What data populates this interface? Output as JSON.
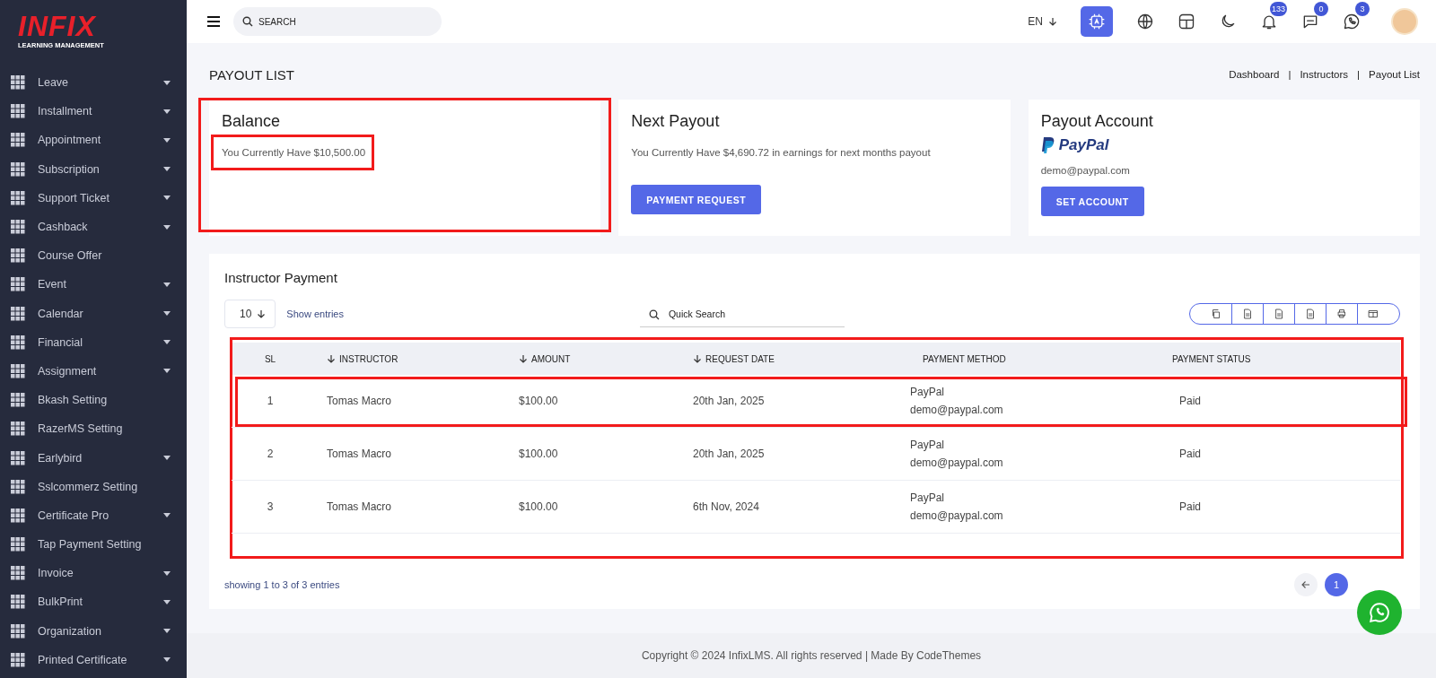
{
  "sidebar": {
    "logo": "INFIX",
    "logo_subtitle": "LEARNING MANAGEMENT",
    "items": [
      {
        "label": "Leave",
        "has_submenu": true
      },
      {
        "label": "Installment",
        "has_submenu": true
      },
      {
        "label": "Appointment",
        "has_submenu": true
      },
      {
        "label": "Subscription",
        "has_submenu": true
      },
      {
        "label": "Support Ticket",
        "has_submenu": true
      },
      {
        "label": "Cashback",
        "has_submenu": true
      },
      {
        "label": "Course Offer",
        "has_submenu": false
      },
      {
        "label": "Event",
        "has_submenu": true
      },
      {
        "label": "Calendar",
        "has_submenu": true
      },
      {
        "label": "Financial",
        "has_submenu": true
      },
      {
        "label": "Assignment",
        "has_submenu": true
      },
      {
        "label": "Bkash Setting",
        "has_submenu": false
      },
      {
        "label": "RazerMS Setting",
        "has_submenu": false
      },
      {
        "label": "Earlybird",
        "has_submenu": true
      },
      {
        "label": "Sslcommerz Setting",
        "has_submenu": false
      },
      {
        "label": "Certificate Pro",
        "has_submenu": true
      },
      {
        "label": "Tap Payment Setting",
        "has_submenu": false
      },
      {
        "label": "Invoice",
        "has_submenu": true
      },
      {
        "label": "BulkPrint",
        "has_submenu": true
      },
      {
        "label": "Organization",
        "has_submenu": true
      },
      {
        "label": "Printed Certificate",
        "has_submenu": true
      }
    ]
  },
  "topbar": {
    "search_placeholder": "SEARCH",
    "language": "EN",
    "notifications_badge": "133",
    "messages_badge": "0",
    "chats_badge": "3"
  },
  "page_title": "PAYOUT LIST",
  "breadcrumbs": [
    "Dashboard",
    "Instructors",
    "Payout List"
  ],
  "breadcrumb_separator": "|",
  "cards": [
    {
      "kind": "balance",
      "title": "Balance",
      "text": "You Currently Have $10,500.00",
      "highlighted": true,
      "text_highlighted": true
    },
    {
      "kind": "payout",
      "title": "Next Payout",
      "text": "You Currently Have $4,690.72 in earnings for next months payout",
      "button": "PAYMENT REQUEST",
      "highlighted": false,
      "text_highlighted": false
    },
    {
      "kind": "account",
      "title": "Payout Account",
      "brand": "PayPal",
      "text": "demo@paypal.com",
      "button": "SET ACCOUNT",
      "highlighted": false,
      "text_highlighted": false
    }
  ],
  "payment": {
    "title": "Instructor Payment",
    "page_size": "10",
    "show_entries": "Show entries",
    "search_placeholder": "Quick Search",
    "highlighted": true,
    "columns": [
      {
        "label": "SL",
        "sortable": false
      },
      {
        "label": "INSTRUCTOR",
        "sortable": true
      },
      {
        "label": "AMOUNT",
        "sortable": true
      },
      {
        "label": "REQUEST DATE",
        "sortable": true
      },
      {
        "label": "PAYMENT METHOD",
        "sortable": false
      },
      {
        "label": "PAYMENT STATUS",
        "sortable": false
      }
    ],
    "rows": [
      {
        "sl": "1",
        "instructor": "Tomas Macro",
        "amount": "$100.00",
        "date": "20th Jan, 2025",
        "method": "PayPal",
        "email": "demo@paypal.com",
        "status": "Paid",
        "highlighted": true
      },
      {
        "sl": "2",
        "instructor": "Tomas Macro",
        "amount": "$100.00",
        "date": "20th Jan, 2025",
        "method": "PayPal",
        "email": "demo@paypal.com",
        "status": "Paid",
        "highlighted": false
      },
      {
        "sl": "3",
        "instructor": "Tomas Macro",
        "amount": "$100.00",
        "date": "6th Nov, 2024",
        "method": "PayPal",
        "email": "demo@paypal.com",
        "status": "Paid",
        "highlighted": false
      }
    ],
    "showing": "showing 1 to 3 of 3 entries",
    "pages": [
      {
        "label": "1",
        "selected": true
      }
    ]
  },
  "footer": "Copyright © 2024 InfixLMS. All rights reserved | Made By CodeThemes"
}
